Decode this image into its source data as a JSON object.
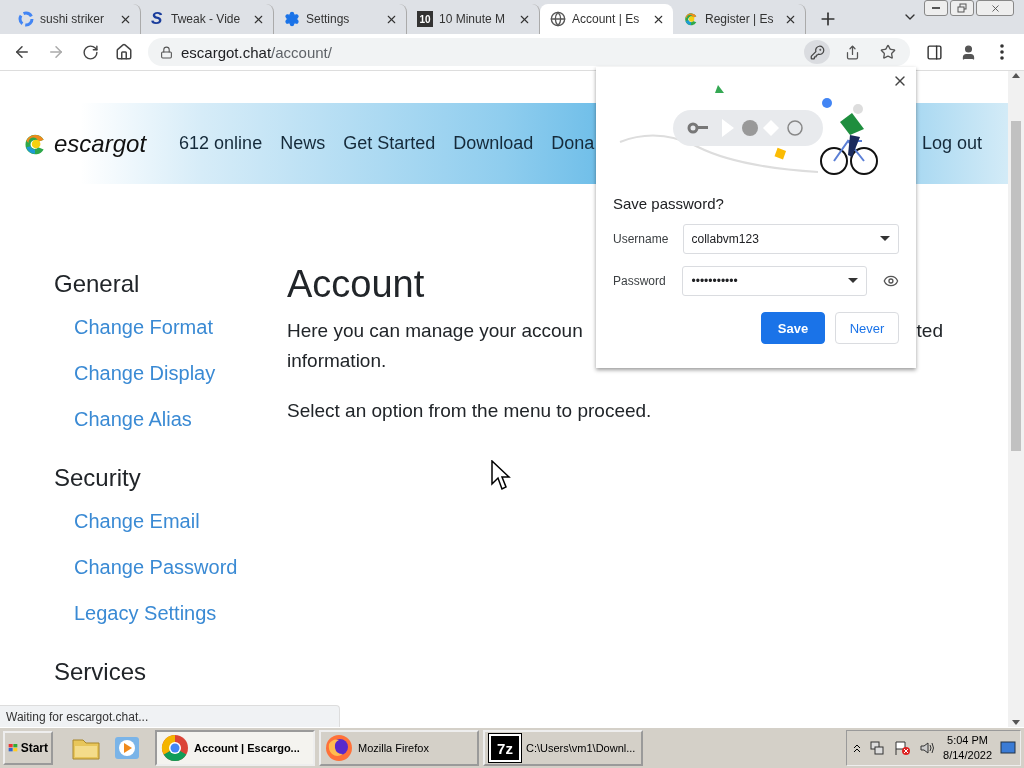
{
  "tabs": [
    {
      "title": "sushi striker",
      "kind": "google",
      "selected": false
    },
    {
      "title": "Tweak - Vide",
      "kind": "letter",
      "badge": "S",
      "selected": false
    },
    {
      "title": "Settings",
      "kind": "gear",
      "selected": false
    },
    {
      "title": "10 Minute M",
      "kind": "square",
      "badge": "10",
      "selected": false
    },
    {
      "title": "Account | Es",
      "kind": "globe",
      "selected": true
    },
    {
      "title": "Register | Es",
      "kind": "escargot",
      "selected": false
    }
  ],
  "address": {
    "host": "escargot.chat",
    "path": "/account/"
  },
  "site": {
    "logo": "escargot",
    "nav": [
      "612 online",
      "News",
      "Get Started",
      "Download",
      "Dona"
    ],
    "logout": "Log out"
  },
  "sidebar": [
    {
      "heading": "General",
      "links": [
        "Change Format",
        "Change Display",
        "Change Alias"
      ]
    },
    {
      "heading": "Security",
      "links": [
        "Change Email",
        "Change Password",
        "Legacy Settings"
      ]
    },
    {
      "heading": "Services"
    }
  ],
  "main": {
    "title": "Account",
    "intro_start": "Here you can manage your accoun",
    "intro_end": "ted",
    "intro_line2": "information.",
    "hint": "Select an option from the menu to proceed."
  },
  "save_password": {
    "title": "Save password?",
    "username_label": "Username",
    "username": "collabvm123",
    "password_label": "Password",
    "password": "•••••••••••",
    "save": "Save",
    "never": "Never"
  },
  "status": "Waiting for escargot.chat...",
  "taskbar": {
    "start": "Start",
    "tasks": [
      {
        "label": "Account | Escargo...",
        "kind": "chrome",
        "selected": true
      },
      {
        "label": "Mozilla Firefox",
        "kind": "firefox",
        "selected": false
      },
      {
        "label": "C:\\Users\\vm1\\Downl...",
        "kind": "zip",
        "badge": "7z",
        "selected": false
      }
    ],
    "time": "5:04 PM",
    "date": "8/14/2022"
  }
}
